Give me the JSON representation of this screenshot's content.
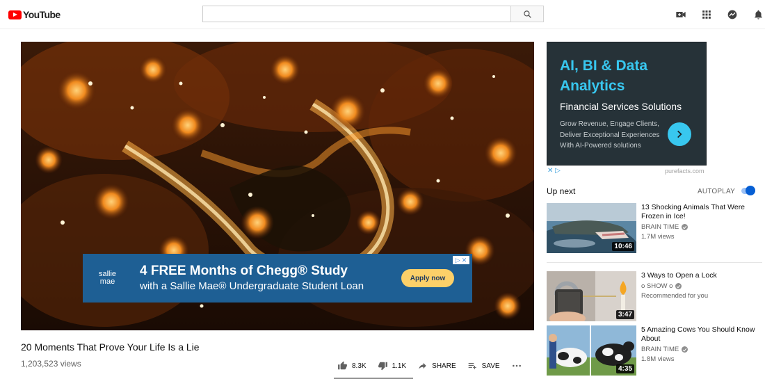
{
  "header": {
    "logo_text": "YouTube",
    "search_placeholder": "",
    "icons": [
      "search-icon",
      "create-video-icon",
      "apps-grid-icon",
      "messages-icon",
      "notifications-bell-icon"
    ]
  },
  "player": {
    "overlay_ad": {
      "brand": [
        "sallie",
        "mae"
      ],
      "headline": "4 FREE Months of Chegg® Study",
      "subline": "with a Sallie Mae® Undergraduate Student Loan",
      "cta": "Apply now",
      "colors": {
        "background": "#1e5f94",
        "cta": "#fcd069"
      }
    }
  },
  "video": {
    "title": "20 Moments That Prove Your Life Is a Lie",
    "views": "1,203,523 views",
    "actions": {
      "like": "8.3K",
      "dislike": "1.1K",
      "share": "SHARE",
      "save": "SAVE"
    }
  },
  "side_ad": {
    "headline": "AI, BI & Data Analytics",
    "subhead": "Financial Services Solutions",
    "body": "Grow Revenue, Engage Clients, Deliver Exceptional Experiences With AI-Powered solutions",
    "domain": "purefacts.com",
    "adchoices": "✕ ▷",
    "colors": {
      "background": "#263238",
      "accent": "#38c7ef"
    }
  },
  "up_next": {
    "label": "Up next",
    "autoplay_label": "AUTOPLAY",
    "autoplay_on": true
  },
  "recommendations": [
    {
      "title": "13 Shocking Animals That Were Frozen in Ice!",
      "channel": "BRAIN TIME",
      "meta": "1.7M views",
      "duration": "10:46"
    },
    {
      "title": "3 Ways to Open a Lock",
      "channel": "o SHOW o",
      "meta": "Recommended for you",
      "duration": "3:47"
    },
    {
      "title": "5 Amazing Cows You Should Know About",
      "channel": "BRAIN TIME",
      "meta": "1.8M views",
      "duration": "4:35"
    }
  ]
}
